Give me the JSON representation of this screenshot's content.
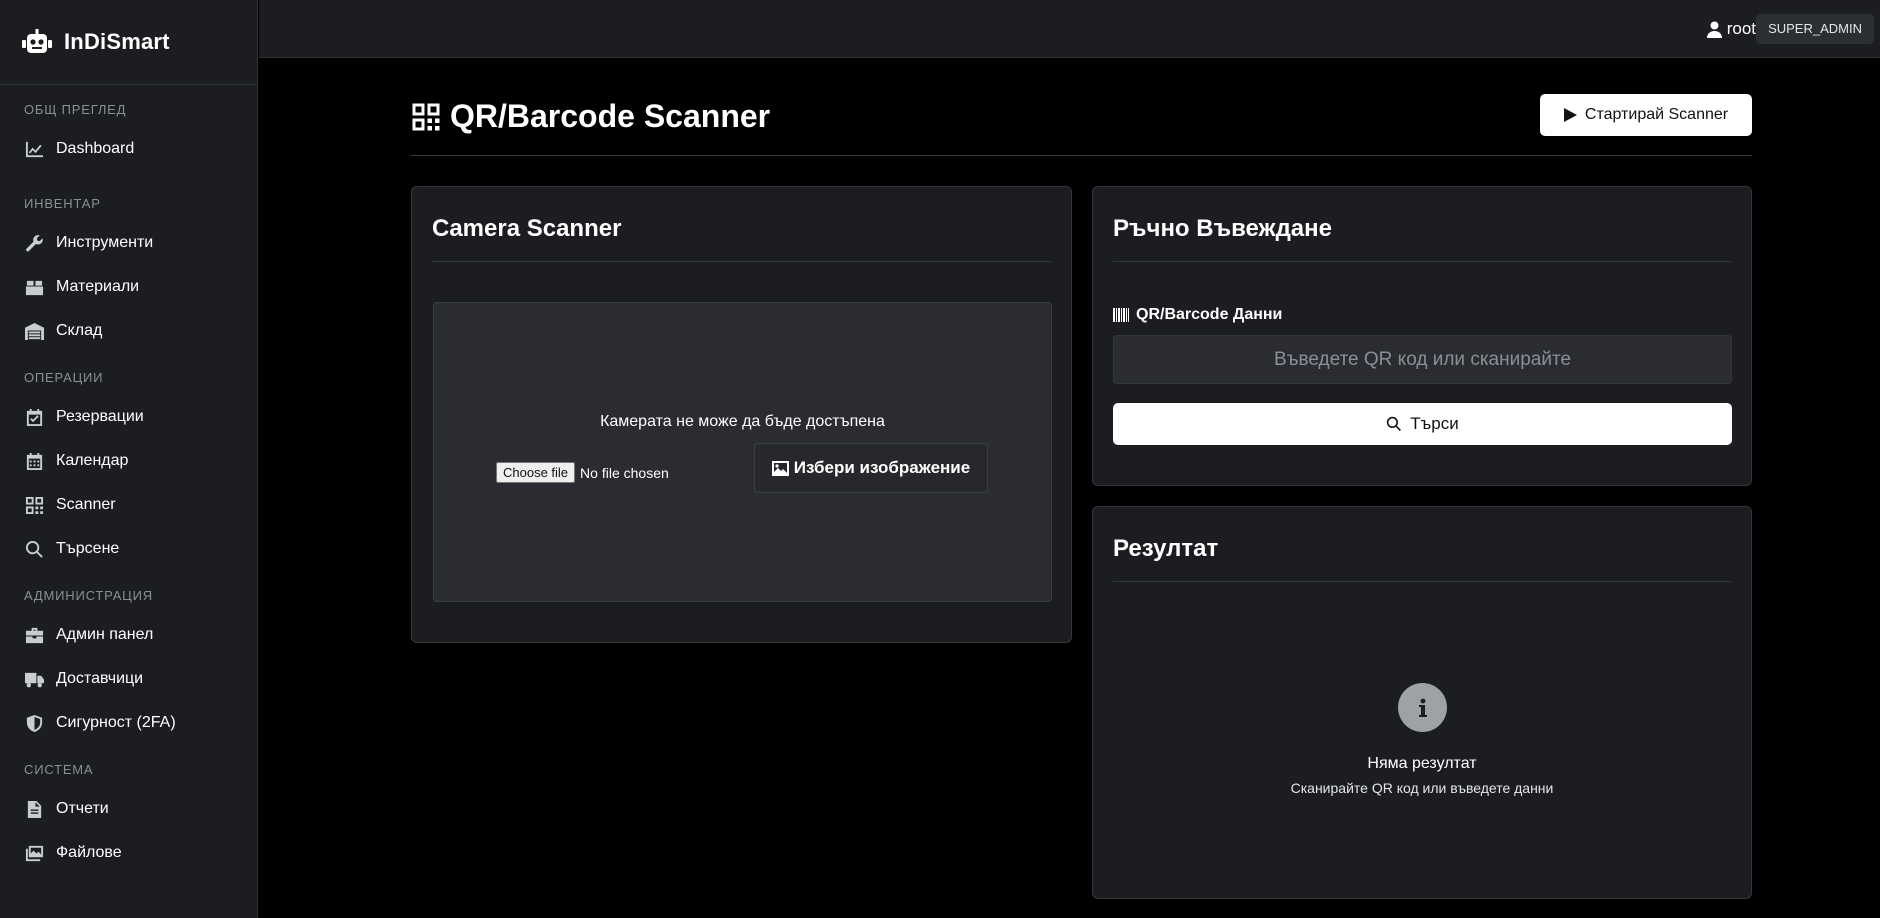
{
  "brand": {
    "name": "InDiSmart",
    "icon": "robot-icon"
  },
  "topbar": {
    "username": "root",
    "role": "SUPER_ADMIN",
    "user_icon": "user-icon"
  },
  "sidebar": {
    "sections": [
      {
        "title": "ОБЩ ПРЕГЛЕД",
        "items": [
          {
            "label": "Dashboard",
            "icon": "chart-line-icon"
          }
        ]
      },
      {
        "title": "ИНВЕНТАР",
        "items": [
          {
            "label": "Инструменти",
            "icon": "wrench-icon"
          },
          {
            "label": "Материали",
            "icon": "box-icon"
          },
          {
            "label": "Склад",
            "icon": "warehouse-icon"
          }
        ]
      },
      {
        "title": "ОПЕРАЦИИ",
        "items": [
          {
            "label": "Резервации",
            "icon": "calendar-check-icon"
          },
          {
            "label": "Календар",
            "icon": "calendar-icon"
          },
          {
            "label": "Scanner",
            "icon": "qrcode-icon"
          },
          {
            "label": "Търсене",
            "icon": "search-icon"
          }
        ]
      },
      {
        "title": "АДМИНИСТРАЦИЯ",
        "items": [
          {
            "label": "Админ панел",
            "icon": "toolbox-icon"
          },
          {
            "label": "Доставчици",
            "icon": "truck-icon"
          },
          {
            "label": "Сигурност (2FA)",
            "icon": "shield-icon"
          }
        ]
      },
      {
        "title": "СИСТЕМА",
        "items": [
          {
            "label": "Отчети",
            "icon": "file-icon"
          },
          {
            "label": "Файлове",
            "icon": "images-icon"
          }
        ]
      }
    ]
  },
  "page": {
    "title": "QR/Barcode Scanner",
    "start_button": "Стартирай Scanner"
  },
  "camera_card": {
    "title": "Camera Scanner",
    "message": "Камерата не може да бъде достъпена",
    "choose_file": "Choose file",
    "no_file": "No file chosen",
    "choose_image": "Избери изображение"
  },
  "manual_card": {
    "title": "Ръчно Въвеждане",
    "field_label": "QR/Barcode Данни",
    "input_value": "",
    "input_placeholder": "Въведете QR код или сканирайте",
    "search_button": "Търси"
  },
  "result_card": {
    "title": "Резултат",
    "empty_title": "Няма резултат",
    "empty_subtitle": "Сканирайте QR код или въведете данни"
  }
}
